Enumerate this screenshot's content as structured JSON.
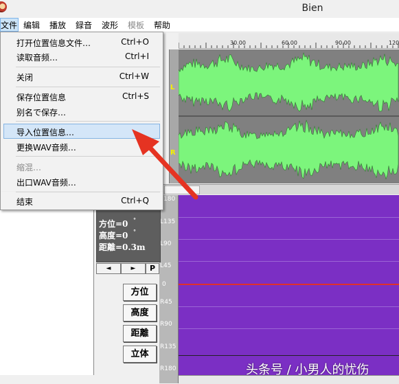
{
  "window": {
    "title": "Bien",
    "icon": "app-icon"
  },
  "menubar": {
    "items": [
      {
        "label": "文件",
        "active": true
      },
      {
        "label": "编辑"
      },
      {
        "label": "播放"
      },
      {
        "label": "録音"
      },
      {
        "label": "波形"
      },
      {
        "label": "模板",
        "disabled": true
      },
      {
        "label": "帮助"
      }
    ]
  },
  "file_menu": {
    "items": [
      {
        "label": "打开位置信息文件…",
        "shortcut": "Ctrl+O"
      },
      {
        "label": "读取音频…",
        "shortcut": "Ctrl+I"
      },
      {
        "label": "关闭",
        "shortcut": "Ctrl+W"
      },
      {
        "label": "保存位置信息",
        "shortcut": "Ctrl+S"
      },
      {
        "label": "别名で保存…",
        "shortcut": ""
      },
      {
        "label": "导入位置信息…",
        "shortcut": "",
        "highlighted": true
      },
      {
        "label": "更换WAV音频…",
        "shortcut": ""
      },
      {
        "label": "缩混…",
        "shortcut": "",
        "disabled": true
      },
      {
        "label": "出口WAV音频…",
        "shortcut": ""
      },
      {
        "label": "结束",
        "shortcut": "Ctrl+Q"
      }
    ]
  },
  "timeline": {
    "ticks": [
      "30.00",
      "60.00",
      "90.00",
      "120"
    ]
  },
  "channels": {
    "left": "L",
    "right": "R"
  },
  "angle_labels": [
    "L180",
    "L135",
    "L90",
    "L45",
    "0",
    "R45",
    "R90",
    "R135",
    "R180"
  ],
  "info_box": {
    "azimuth": "方位=0",
    "elevation": "高度=0",
    "distance": "距離=0.3m",
    "deg": "°"
  },
  "nav": {
    "prev": "◄",
    "next": "►",
    "p": "P"
  },
  "side_buttons": [
    "方位",
    "高度",
    "距離",
    "立体"
  ],
  "colors": {
    "waveform": "#7cf57c",
    "wave_bg": "#808080",
    "position_panel": "#7b2fc4",
    "zero_line": "#e0312a",
    "annotation_arrow": "#e53322",
    "menu_highlight": "#d4e6f8"
  },
  "watermark": "头条号 / 小男人的忧伤"
}
